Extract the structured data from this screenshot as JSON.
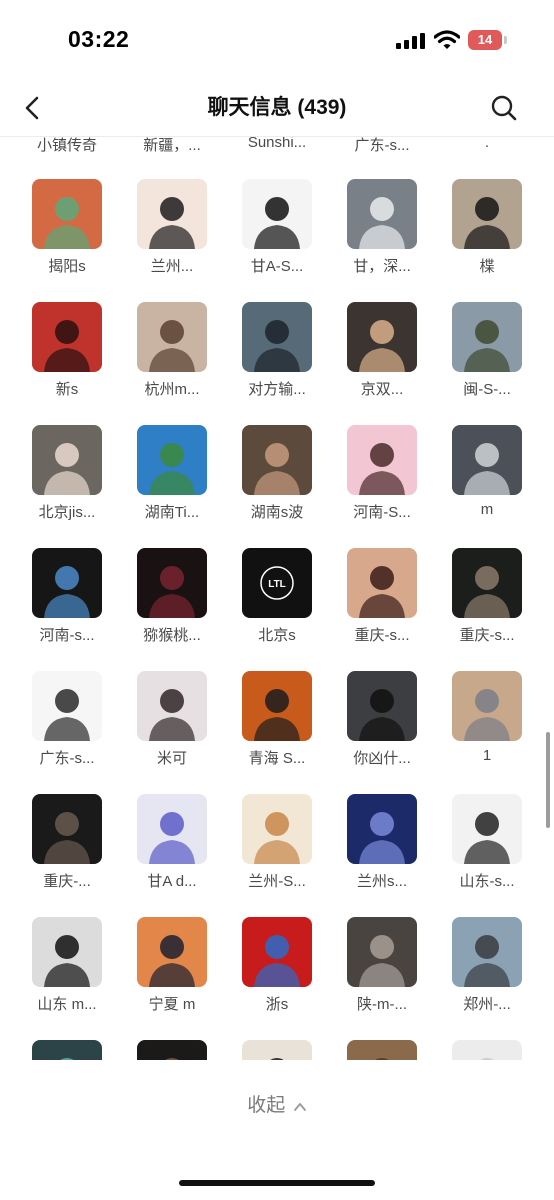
{
  "status_bar": {
    "time": "03:22",
    "battery": "14"
  },
  "header": {
    "title": "聊天信息 (439)"
  },
  "icons": {
    "back": "chevron-left-icon",
    "search": "search-icon",
    "collapse": "chevron-up-icon"
  },
  "partial_row": [
    "小镇传奇",
    "新疆，...",
    "Sunshi...",
    "广东-s...",
    "."
  ],
  "members": [
    {
      "name": "揭阳s",
      "avatar": "jade-pendant",
      "bg": "#d46a44",
      "fg": "#5aa87a"
    },
    {
      "name": "兰州...",
      "avatar": "praying-figure",
      "bg": "#f3e4dc",
      "fg": "#1c1c1c"
    },
    {
      "name": "甘A-S...",
      "avatar": "silhouette-person",
      "bg": "#f4f4f4",
      "fg": "#111111"
    },
    {
      "name": "甘，深...",
      "avatar": "anime-white-hair",
      "bg": "#7a8088",
      "fg": "#e9ecef"
    },
    {
      "name": "楪",
      "avatar": "black-white-cat",
      "bg": "#b2a290",
      "fg": "#151515"
    },
    {
      "name": "新s",
      "avatar": "red-sky-figure",
      "bg": "#c0332c",
      "fg": "#2a1010"
    },
    {
      "name": "杭州m...",
      "avatar": "girl-with-pet",
      "bg": "#c9b4a4",
      "fg": "#5a4030"
    },
    {
      "name": "对方输...",
      "avatar": "man-in-room",
      "bg": "#576a78",
      "fg": "#1c232a"
    },
    {
      "name": "京双...",
      "avatar": "man-with-cat",
      "bg": "#3c3430",
      "fg": "#d8b08c"
    },
    {
      "name": "闽-S-...",
      "avatar": "mountain-chair",
      "bg": "#8a9aa6",
      "fg": "#3f4a30"
    },
    {
      "name": "北京jis...",
      "avatar": "girl-portrait",
      "bg": "#6c6660",
      "fg": "#eadad0"
    },
    {
      "name": "湖南Ti...",
      "avatar": "blue-lake",
      "bg": "#2f7fc6",
      "fg": "#3a8a3a"
    },
    {
      "name": "湖南s波",
      "avatar": "boy-portrait",
      "bg": "#5c4a3c",
      "fg": "#c49a7c"
    },
    {
      "name": "河南-S...",
      "avatar": "pink-anime-girl",
      "bg": "#f2c6d2",
      "fg": "#4a2a2a"
    },
    {
      "name": "m",
      "avatar": "umbrella-anime",
      "bg": "#4c5058",
      "fg": "#cfd4d8"
    },
    {
      "name": "河南-s...",
      "avatar": "cat-closeup",
      "bg": "#161616",
      "fg": "#4a8ac8"
    },
    {
      "name": "猕猴桃...",
      "avatar": "dark-hair-woman",
      "bg": "#1a1212",
      "fg": "#7a2430"
    },
    {
      "name": "北京s",
      "avatar": "ltl-logo",
      "bg": "#111111",
      "fg": "#ffffff",
      "logo_text": "LTL"
    },
    {
      "name": "重庆-s...",
      "avatar": "anime-red-girl",
      "bg": "#d8a88c",
      "fg": "#3a1c18"
    },
    {
      "name": "重庆-s...",
      "avatar": "dark-portrait",
      "bg": "#1c1e1c",
      "fg": "#8a7a6a"
    },
    {
      "name": "广东-s...",
      "avatar": "white-blank",
      "bg": "#f6f6f6",
      "fg": "#2a2a2a"
    },
    {
      "name": "米可",
      "avatar": "girl-face",
      "bg": "#e6e0e2",
      "fg": "#302628"
    },
    {
      "name": "青海 S...",
      "avatar": "anime-fire",
      "bg": "#c85a1c",
      "fg": "#1c1c1c"
    },
    {
      "name": "你凶什...",
      "avatar": "car-hoodie",
      "bg": "#3c3e42",
      "fg": "#111111"
    },
    {
      "name": "1",
      "avatar": "sunset-gradient",
      "bg": "#c8a88a",
      "fg": "#7a7e88"
    },
    {
      "name": "重庆-...",
      "avatar": "dark-boy",
      "bg": "#1a1a1a",
      "fg": "#6a5a50"
    },
    {
      "name": "甘A d...",
      "avatar": "sketch-anime",
      "bg": "#e6e6f2",
      "fg": "#5a5ac8"
    },
    {
      "name": "兰州-S...",
      "avatar": "cartoon-capybara",
      "bg": "#f2e6d4",
      "fg": "#c8864a"
    },
    {
      "name": "兰州s...",
      "avatar": "moon-cartoon",
      "bg": "#1c2a6a",
      "fg": "#7a8ad8"
    },
    {
      "name": "山东-s...",
      "avatar": "white-hair-sketch",
      "bg": "#f2f2f2",
      "fg": "#222222"
    },
    {
      "name": "山东 m...",
      "avatar": "anime-lying",
      "bg": "#dcdcdc",
      "fg": "#111111"
    },
    {
      "name": "宁夏 m",
      "avatar": "sunset-group",
      "bg": "#e2864a",
      "fg": "#1c2030"
    },
    {
      "name": "浙s",
      "avatar": "red-cartoon",
      "bg": "#c81c1c",
      "fg": "#2a6ac8"
    },
    {
      "name": "陕-m-...",
      "avatar": "armored-anime",
      "bg": "#4a4440",
      "fg": "#a8a098"
    },
    {
      "name": "郑州-...",
      "avatar": "street-girl",
      "bg": "#8aa2b4",
      "fg": "#3a3c40"
    }
  ],
  "partial_avatars": [
    {
      "avatar": "teal-circle",
      "bg": "#2c4448",
      "fg": "#5ab2aa"
    },
    {
      "avatar": "boy-dark",
      "bg": "#1c1a18",
      "fg": "#7a5c48"
    },
    {
      "avatar": "boy-hair",
      "bg": "#e8e2d8",
      "fg": "#1c1a18"
    },
    {
      "avatar": "warm-photo",
      "bg": "#8a6a4a",
      "fg": "#4a3a28"
    },
    {
      "avatar": "default-avatar",
      "bg": "#ececec",
      "fg": "#c8c8c8"
    }
  ],
  "collapse": {
    "label": "收起"
  }
}
